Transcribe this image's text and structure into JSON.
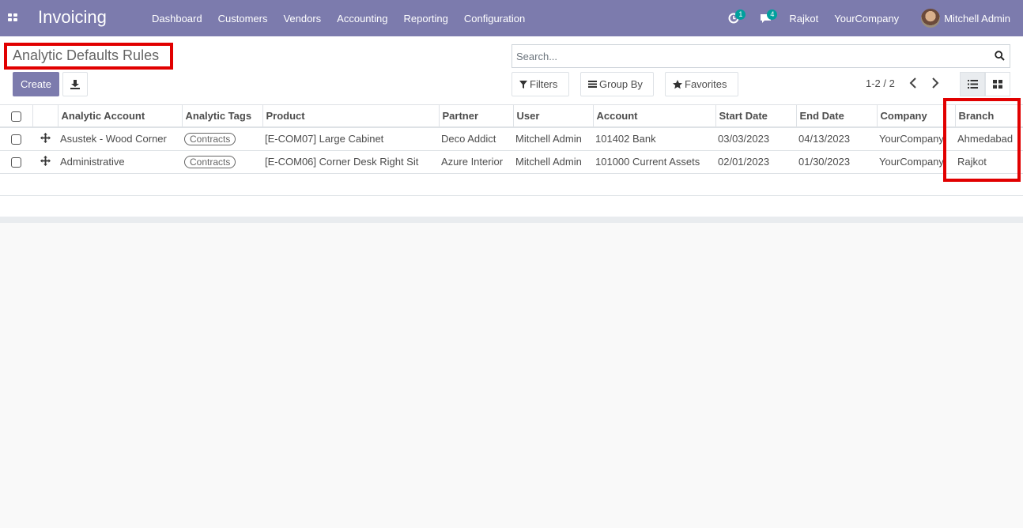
{
  "navbar": {
    "app_name": "Invoicing",
    "menu": [
      "Dashboard",
      "Customers",
      "Vendors",
      "Accounting",
      "Reporting",
      "Configuration"
    ],
    "activity_count": "1",
    "messages_count": "4",
    "branch": "Rajkot",
    "company": "YourCompany",
    "user": "Mitchell Admin"
  },
  "control_panel": {
    "title": "Analytic Defaults Rules",
    "create_label": "Create",
    "search_placeholder": "Search...",
    "filters_label": "Filters",
    "groupby_label": "Group By",
    "favorites_label": "Favorites",
    "pager": "1-2 / 2"
  },
  "table": {
    "columns": [
      "Analytic Account",
      "Analytic Tags",
      "Product",
      "Partner",
      "User",
      "Account",
      "Start Date",
      "End Date",
      "Company",
      "Branch"
    ],
    "rows": [
      {
        "analytic_account": "Asustek - Wood Corner",
        "analytic_tags": "Contracts",
        "product": "[E-COM07] Large Cabinet",
        "partner": "Deco Addict",
        "user": "Mitchell Admin",
        "account": "101402 Bank",
        "start_date": "03/03/2023",
        "end_date": "04/13/2023",
        "company": "YourCompany",
        "branch": "Ahmedabad"
      },
      {
        "analytic_account": "Administrative",
        "analytic_tags": "Contracts",
        "product": "[E-COM06] Corner Desk Right Sit",
        "partner": "Azure Interior",
        "user": "Mitchell Admin",
        "account": "101000 Current Assets",
        "start_date": "02/01/2023",
        "end_date": "01/30/2023",
        "company": "YourCompany",
        "branch": "Rajkot"
      }
    ]
  },
  "colors": {
    "navbar": "#7c7bad",
    "badge": "#00a09d",
    "highlight": "#e10000"
  }
}
